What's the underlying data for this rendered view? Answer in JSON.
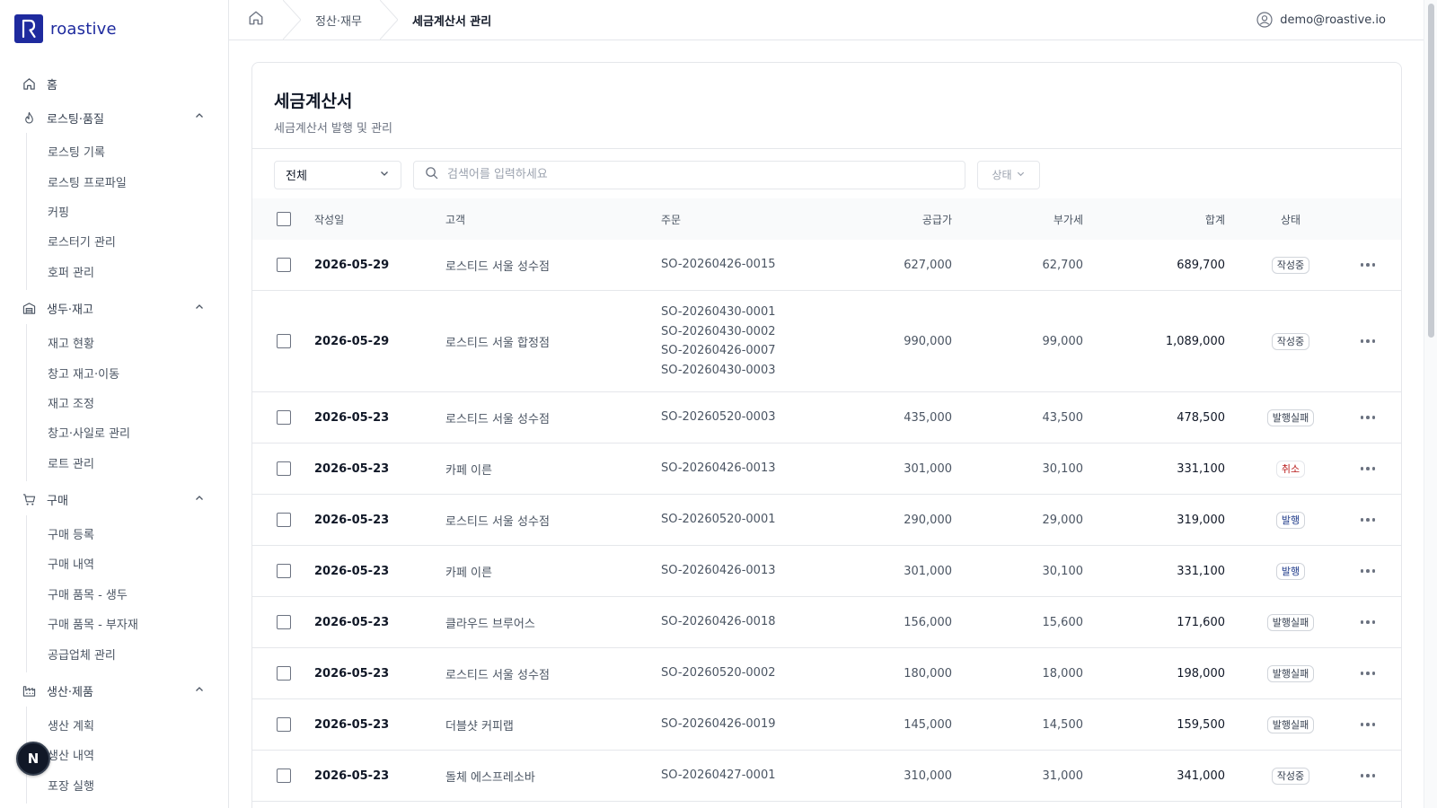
{
  "brand": {
    "name": "roastive",
    "mark": "R"
  },
  "nav": {
    "home": "홈",
    "groups": [
      {
        "label": "로스팅·품질",
        "icon": "flame-icon",
        "items": [
          "로스팅 기록",
          "로스팅 프로파일",
          "커핑",
          "로스터기 관리",
          "호퍼 관리"
        ]
      },
      {
        "label": "생두·재고",
        "icon": "warehouse-icon",
        "items": [
          "재고 현황",
          "창고 재고·이동",
          "재고 조정",
          "창고·사일로 관리",
          "로트 관리"
        ]
      },
      {
        "label": "구매",
        "icon": "cart-icon",
        "items": [
          "구매 등록",
          "구매 내역",
          "구매 품목 - 생두",
          "구매 품목 - 부자재",
          "공급업체 관리"
        ]
      },
      {
        "label": "생산·제품",
        "icon": "factory-icon",
        "items": [
          "생산 계획",
          "생산 내역",
          "포장 실행"
        ]
      }
    ]
  },
  "fab": {
    "label": "N"
  },
  "breadcrumb": [
    "정산·재무",
    "세금계산서 관리"
  ],
  "user": {
    "email": "demo@roastive.io"
  },
  "page": {
    "title": "세금계산서",
    "subtitle": "세금계산서 발행 및 관리"
  },
  "filters": {
    "type_value": "전체",
    "search_placeholder": "검색어를 입력하세요",
    "status_label": "상태"
  },
  "table": {
    "columns": {
      "date": "작성일",
      "customer": "고객",
      "order": "주문",
      "supply": "공급가",
      "vat": "부가세",
      "total": "합계",
      "status": "상태"
    },
    "rows": [
      {
        "date": "2026-05-29",
        "customer": "로스티드 서울 성수점",
        "orders": [
          "SO-20260426-0015"
        ],
        "supply": "627,000",
        "vat": "62,700",
        "total": "689,700",
        "status": "작성중",
        "status_kind": "draft"
      },
      {
        "date": "2026-05-29",
        "customer": "로스티드 서울 합정점",
        "orders": [
          "SO-20260430-0001",
          "SO-20260430-0002",
          "SO-20260426-0007",
          "SO-20260430-0003"
        ],
        "supply": "990,000",
        "vat": "99,000",
        "total": "1,089,000",
        "status": "작성중",
        "status_kind": "draft"
      },
      {
        "date": "2026-05-23",
        "customer": "로스티드 서울 성수점",
        "orders": [
          "SO-20260520-0003"
        ],
        "supply": "435,000",
        "vat": "43,500",
        "total": "478,500",
        "status": "발행실패",
        "status_kind": "failed"
      },
      {
        "date": "2026-05-23",
        "customer": "카페 이른",
        "orders": [
          "SO-20260426-0013"
        ],
        "supply": "301,000",
        "vat": "30,100",
        "total": "331,100",
        "status": "취소",
        "status_kind": "cancel"
      },
      {
        "date": "2026-05-23",
        "customer": "로스티드 서울 성수점",
        "orders": [
          "SO-20260520-0001"
        ],
        "supply": "290,000",
        "vat": "29,000",
        "total": "319,000",
        "status": "발행",
        "status_kind": "issued"
      },
      {
        "date": "2026-05-23",
        "customer": "카페 이른",
        "orders": [
          "SO-20260426-0013"
        ],
        "supply": "301,000",
        "vat": "30,100",
        "total": "331,100",
        "status": "발행",
        "status_kind": "issued"
      },
      {
        "date": "2026-05-23",
        "customer": "클라우드 브루어스",
        "orders": [
          "SO-20260426-0018"
        ],
        "supply": "156,000",
        "vat": "15,600",
        "total": "171,600",
        "status": "발행실패",
        "status_kind": "failed"
      },
      {
        "date": "2026-05-23",
        "customer": "로스티드 서울 성수점",
        "orders": [
          "SO-20260520-0002"
        ],
        "supply": "180,000",
        "vat": "18,000",
        "total": "198,000",
        "status": "발행실패",
        "status_kind": "failed"
      },
      {
        "date": "2026-05-23",
        "customer": "더블샷 커피랩",
        "orders": [
          "SO-20260426-0019"
        ],
        "supply": "145,000",
        "vat": "14,500",
        "total": "159,500",
        "status": "발행실패",
        "status_kind": "failed"
      },
      {
        "date": "2026-05-23",
        "customer": "돌체 에스프레소바",
        "orders": [
          "SO-20260427-0001"
        ],
        "supply": "310,000",
        "vat": "31,000",
        "total": "341,000",
        "status": "작성중",
        "status_kind": "draft"
      }
    ]
  },
  "colors": {
    "brand": "#1e2a9e",
    "border": "#e5e7eb",
    "cancel": "#b91c1c",
    "issued": "#1e3a8a"
  }
}
